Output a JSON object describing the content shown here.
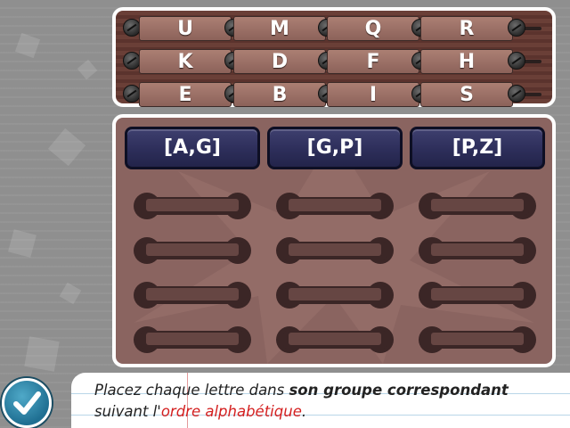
{
  "letters": {
    "rows": [
      [
        "U",
        "M",
        "Q",
        "R"
      ],
      [
        "K",
        "D",
        "F",
        "H"
      ],
      [
        "E",
        "B",
        "I",
        "S"
      ]
    ]
  },
  "groups": [
    {
      "label": "[A,G]"
    },
    {
      "label": "[G,P]"
    },
    {
      "label": "[P,Z]"
    }
  ],
  "slots_per_group": 4,
  "instruction": {
    "part1": "Placez chaque lettre dans ",
    "bold": "son groupe correspondant",
    "part2": "suivant l'",
    "highlight": "ordre alphabétique",
    "end": "."
  },
  "colors": {
    "group_header": "#2d2e5a",
    "highlight": "#d42020"
  },
  "icons": {
    "check_button": "checkmark-icon"
  }
}
